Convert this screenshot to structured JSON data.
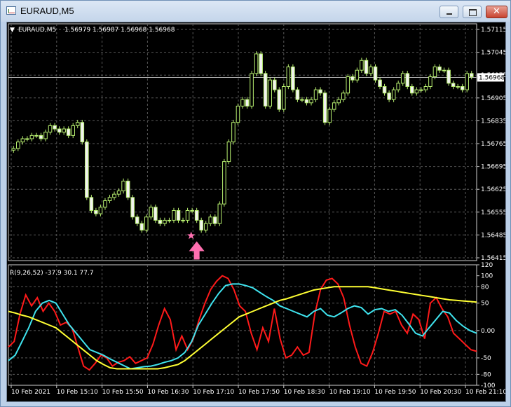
{
  "window": {
    "title": "EURAUD,M5",
    "buttons": {
      "minimize": "minimize",
      "maximize": "maximize",
      "close": "✕"
    }
  },
  "price_panel": {
    "header_symbol": "EURAUD,M5",
    "header_values": "1.56979 1.56987 1.56968 1.56968",
    "current_price": "1.56968",
    "y_ticks": [
      "1.57115",
      "1.57045",
      "1.56975",
      "1.56905",
      "1.56835",
      "1.56765",
      "1.56695",
      "1.56625",
      "1.56555",
      "1.56485",
      "1.56415"
    ]
  },
  "indicator_panel": {
    "header": "R(9,26,52) -37.9 30.1 77.7",
    "y_ticks": [
      "120",
      "100",
      "80",
      "50",
      "0.00",
      "-50",
      "-80",
      "-100"
    ]
  },
  "x_axis_labels": [
    "10 Feb 2021",
    "10 Feb 15:10",
    "10 Feb 15:50",
    "10 Feb 16:30",
    "10 Feb 17:10",
    "10 Feb 17:50",
    "10 Feb 18:30",
    "10 Feb 19:10",
    "10 Feb 19:50",
    "10 Feb 20:30",
    "10 Feb 21:10"
  ],
  "colors": {
    "background": "#000000",
    "grid": "#5a5a5a",
    "candle": "#b8f070",
    "signal": "#ff6fb0",
    "rsi_fast": "#ff1a1a",
    "rsi_mid": "#3fe3ee",
    "rsi_slow": "#ffff33",
    "price_line": "#c0c0c0"
  },
  "chart_data": {
    "type": "candlestick",
    "symbol": "EURAUD",
    "timeframe": "M5",
    "ylim": [
      1.56415,
      1.57115
    ],
    "close": [
      1.5675,
      1.5677,
      1.5678,
      1.5678,
      1.5679,
      1.5679,
      1.5678,
      1.568,
      1.5682,
      1.5681,
      1.568,
      1.5681,
      1.5679,
      1.5682,
      1.5683,
      1.5677,
      1.566,
      1.5656,
      1.5655,
      1.5657,
      1.5659,
      1.566,
      1.5661,
      1.5662,
      1.5665,
      1.566,
      1.5654,
      1.5652,
      1.565,
      1.5654,
      1.5657,
      1.5653,
      1.5652,
      1.5653,
      1.5653,
      1.5656,
      1.5653,
      1.5653,
      1.5656,
      1.5656,
      1.5653,
      1.565,
      1.5652,
      1.5654,
      1.5652,
      1.5658,
      1.5671,
      1.5677,
      1.5683,
      1.5688,
      1.569,
      1.5688,
      1.5698,
      1.5704,
      1.5698,
      1.5688,
      1.5696,
      1.5693,
      1.5687,
      1.5694,
      1.57,
      1.5693,
      1.569,
      1.569,
      1.5689,
      1.569,
      1.5693,
      1.5692,
      1.5683,
      1.5687,
      1.5689,
      1.569,
      1.5692,
      1.5697,
      1.5696,
      1.5699,
      1.5702,
      1.5698,
      1.57,
      1.5696,
      1.5694,
      1.5692,
      1.569,
      1.5693,
      1.5695,
      1.5698,
      1.5694,
      1.5692,
      1.5693,
      1.5693,
      1.5694,
      1.5697,
      1.57,
      1.5699,
      1.5699,
      1.5695,
      1.5694,
      1.5694,
      1.5693,
      1.5698,
      1.5697
    ],
    "signals": [
      {
        "type": "buy-arrow",
        "bar": 40
      },
      {
        "type": "star",
        "bar": 40
      }
    ],
    "indicator": {
      "name": "R(9,26,52)",
      "ylim": [
        -100,
        120
      ],
      "levels": [
        80,
        50,
        0,
        -50,
        -80
      ],
      "series": [
        {
          "period": 9,
          "last": -37.9,
          "values": [
            -30,
            -20,
            30,
            65,
            45,
            60,
            35,
            50,
            35,
            10,
            15,
            5,
            -30,
            -65,
            -72,
            -60,
            -45,
            -50,
            -65,
            -58,
            -55,
            -48,
            -60,
            -55,
            -50,
            -25,
            10,
            40,
            20,
            -35,
            -10,
            -35,
            -15,
            20,
            50,
            75,
            90,
            100,
            95,
            75,
            45,
            35,
            -5,
            -35,
            5,
            -20,
            40,
            -15,
            -50,
            -45,
            -30,
            -45,
            -40,
            30,
            75,
            92,
            95,
            85,
            60,
            10,
            -30,
            -60,
            -65,
            -40,
            -5,
            35,
            30,
            35,
            10,
            -5,
            30,
            20,
            -15,
            50,
            60,
            40,
            25,
            -5,
            -15,
            -25,
            -35,
            -38
          ]
        },
        {
          "period": 26,
          "last": 30.1,
          "values": [
            -55,
            -45,
            -20,
            5,
            35,
            50,
            55,
            50,
            30,
            10,
            -5,
            -20,
            -35,
            -40,
            -45,
            -52,
            -58,
            -64,
            -70,
            -68,
            -66,
            -65,
            -62,
            -58,
            -55,
            -50,
            -40,
            -20,
            10,
            30,
            50,
            68,
            82,
            85,
            85,
            82,
            78,
            70,
            62,
            55,
            45,
            40,
            35,
            30,
            25,
            35,
            40,
            28,
            25,
            32,
            40,
            45,
            42,
            30,
            38,
            40,
            35,
            38,
            28,
            12,
            -5,
            -10,
            5,
            20,
            35,
            32,
            18,
            8,
            0,
            -5
          ]
        },
        {
          "period": 52,
          "last": 77.7,
          "values": [
            35,
            32,
            28,
            25,
            20,
            15,
            10,
            5,
            -5,
            -15,
            -25,
            -35,
            -45,
            -55,
            -62,
            -68,
            -70,
            -70,
            -70,
            -70,
            -70,
            -70,
            -70,
            -68,
            -65,
            -62,
            -55,
            -45,
            -35,
            -25,
            -15,
            -5,
            5,
            15,
            25,
            30,
            35,
            40,
            45,
            50,
            55,
            58,
            62,
            66,
            70,
            74,
            76,
            78,
            80,
            80,
            80,
            80,
            80,
            80,
            78,
            76,
            74,
            72,
            70,
            68,
            66,
            64,
            62,
            60,
            58,
            56,
            55,
            54,
            53,
            52
          ]
        }
      ]
    }
  }
}
